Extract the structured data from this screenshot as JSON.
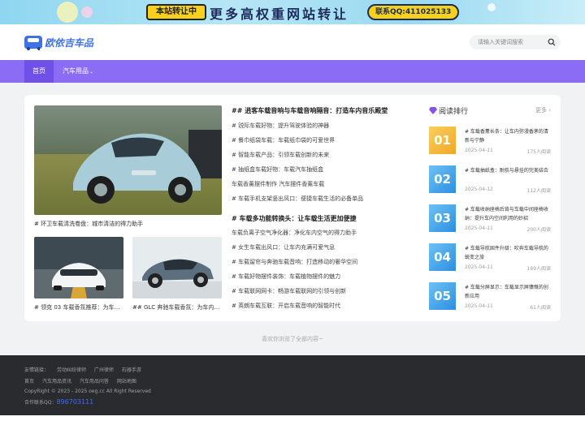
{
  "banner": {
    "tag": "本站转让中",
    "headline": "更多高权重网站转让",
    "contact": "联系QQ:411025133"
  },
  "header": {
    "logo_text": "欧依吉车品",
    "search_placeholder": "请输入关键词搜索"
  },
  "nav": {
    "items": [
      {
        "label": "首页",
        "active": true
      },
      {
        "label": "汽车用品",
        "has_dropdown": true
      }
    ]
  },
  "featured": {
    "hero_caption": "# 环卫车载清洗卷盘：城市清洁的得力助手",
    "thumb1_caption": "# 领克 03 车载香氛推荐：为车内增添迷人香气",
    "thumb2_caption": "## GLC 奔驰车载香氛：为车内空间增添迷人气息"
  },
  "sections": [
    {
      "title": "## 逍客车载音响与车载音响隔音：打造车内音乐殿堂",
      "items": [
        "# 锐际车载好物：提升驾驶体验的神器",
        "# 餐巾纸袋车载：车载纸巾袋的可爱世界",
        "# 智能车载产品：引领车载创新的未来",
        "# 抽纸盒车载好物：车载汽车抽纸盒",
        "车载香薰摆件制作 汽车摆件香薰车载",
        "# 车载手机支架竖出风口：便捷车载生活的必备单品"
      ]
    },
    {
      "title": "# 车载多功能转换头：让车载生活更加便捷",
      "items": [
        "车载负离子空气净化器：净化车内空气的得力助手",
        "# 女生车载出风口：让车内充满可爱气息",
        "# 车载留帘与奔驰车载音响：打造移动的奢华空间",
        "# 车载好物摆件装饰：车载植物摆件的魅力",
        "# 车载联网网卡：畅游车载联网的引领与创新",
        "# 英朗车载互联：开启车载音响的智能时代"
      ]
    }
  ],
  "ranking": {
    "title": "阅读排行",
    "more_label": "更多",
    "items": [
      {
        "num": "01",
        "title": "# 车载香薰长条：让车内弥漫香茅的清新与宁静",
        "date": "2025-04-11",
        "reads": "175人阅读",
        "color": "#f5b93b"
      },
      {
        "num": "02",
        "title": "# 车载抽纸盒：耐航与悬挂的完美结合",
        "date": "2025-04-12",
        "reads": "112人阅读",
        "color": "#3ca2ea"
      },
      {
        "num": "03",
        "title": "# 车载收纳座椅后背与车载中间座椅收纳：提升车内空间利用的妙招",
        "date": "2025-04-11",
        "reads": "200人阅读",
        "color": "#3ca2ea"
      },
      {
        "num": "04",
        "title": "# 车载导航固件升级：吹奔车载导航的蜕变之旅",
        "date": "2025-04-11",
        "reads": "169人阅读",
        "color": "#3ca2ea"
      },
      {
        "num": "05",
        "title": "# 车载分屏显示：车载显示屏慷慨的创新应用",
        "date": "2025-04-11",
        "reads": "61人阅读",
        "color": "#3ca2ea"
      }
    ]
  },
  "loaded_text": "喜欢你浏览了全部内容~",
  "footer": {
    "links_label": "友情链接：",
    "links": [
      "劳动纠纷律师",
      "广州律师",
      "石器手游"
    ],
    "nav_links": [
      "首页",
      "汽车用品资讯",
      "汽车用品问答",
      "网站地图"
    ],
    "copyright": "CopyRight © 2023 - 2025 oeg.cc All Right Reserved",
    "contact_label": "合作联系QQ：",
    "contact_qq": "896703111"
  }
}
